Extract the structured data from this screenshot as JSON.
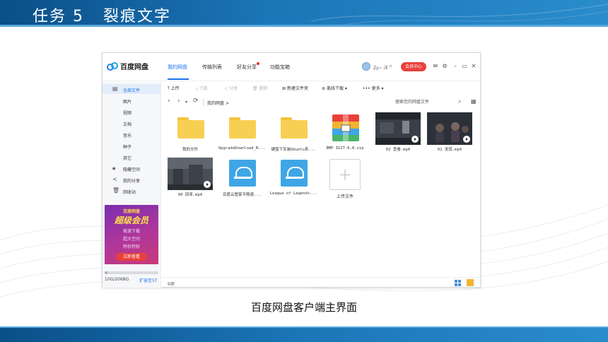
{
  "slide": {
    "title": "任务 5   裂痕文字",
    "caption": "百度网盘客户端主界面"
  },
  "app": {
    "logo_text": "百度网盘",
    "nav_tabs": [
      "我的网盘",
      "传输列表",
      "好友分享",
      "功能宝箱"
    ],
    "active_tab": "我的网盘",
    "username": "Zy~ 洋",
    "member_button": "会员中心",
    "sidebar": [
      {
        "label": "全部文件",
        "icon": "document-icon",
        "active": true
      },
      {
        "label": "图片"
      },
      {
        "label": "视频"
      },
      {
        "label": "文档"
      },
      {
        "label": "音乐"
      },
      {
        "label": "种子"
      },
      {
        "label": "其它"
      },
      {
        "label": "隐藏空间",
        "icon": "lock-icon"
      },
      {
        "label": "我的分享",
        "icon": "share-icon"
      },
      {
        "label": "回收站",
        "icon": "trash-icon"
      }
    ],
    "promo": {
      "line1": "百度网盘",
      "line2": "超级会员",
      "features": [
        "极速下载",
        "超大空间",
        "特权特权"
      ],
      "button": "立即查看"
    },
    "quota": {
      "text": "10G/2068G",
      "link": "扩容至5T",
      "used_fraction": 0.05
    },
    "toolbar": [
      {
        "label": "上传",
        "icon": "upload-icon",
        "enabled": true
      },
      {
        "label": "下载",
        "icon": "download-icon",
        "enabled": false
      },
      {
        "label": "分享",
        "icon": "share-icon",
        "enabled": false
      },
      {
        "label": "删除",
        "icon": "delete-icon",
        "enabled": false
      },
      {
        "label": "新建文件夹",
        "icon": "new-folder-icon",
        "enabled": true
      },
      {
        "label": "离线下载",
        "icon": "offline-download-icon",
        "enabled": true
      },
      {
        "label": "更多",
        "icon": "more-icon",
        "enabled": true
      }
    ],
    "breadcrumb": "我的网盘  >",
    "search_placeholder": "搜索您的网盘文件",
    "files": [
      {
        "name": "我的文件",
        "kind": "folder"
      },
      {
        "name": "UpgradeDownload_B...",
        "kind": "folder"
      },
      {
        "name": "硬盘下安装Ubuntu系...",
        "kind": "folder"
      },
      {
        "name": "BMP IGIT-0.8.zip",
        "kind": "zip"
      },
      {
        "name": "02 查看.mp4",
        "kind": "video"
      },
      {
        "name": "01 发现.mp4",
        "kind": "video"
      },
      {
        "name": "00 回来.mp4",
        "kind": "video"
      },
      {
        "name": "百度云管家不限速...",
        "kind": "exe"
      },
      {
        "name": "League of Legends...",
        "kind": "exe"
      },
      {
        "name": "上传文件",
        "kind": "upload"
      }
    ],
    "status_count": "9项"
  }
}
